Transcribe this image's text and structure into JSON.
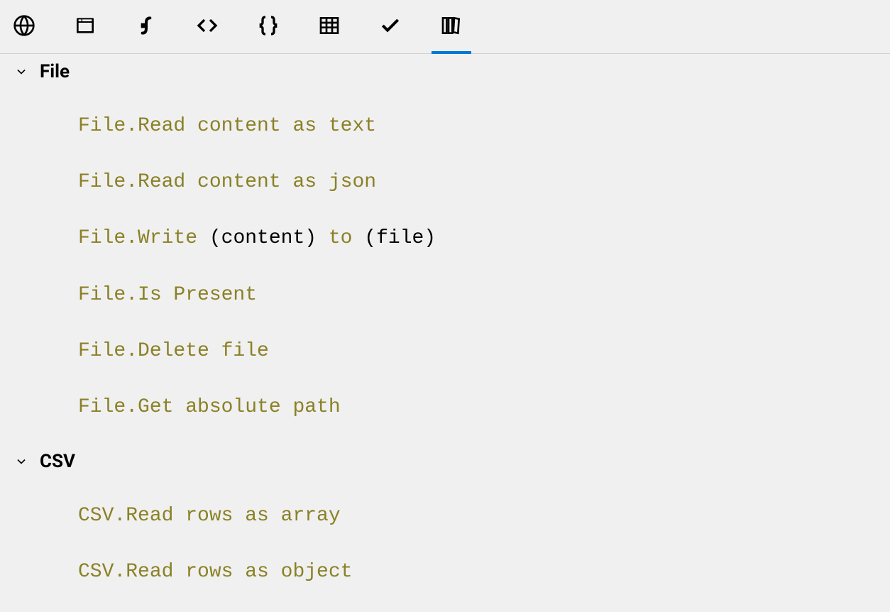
{
  "toolbar": {
    "tabs": [
      {
        "name": "globe-icon"
      },
      {
        "name": "browser-icon"
      },
      {
        "name": "function-icon"
      },
      {
        "name": "code-icon"
      },
      {
        "name": "braces-icon"
      },
      {
        "name": "table-icon"
      },
      {
        "name": "check-icon"
      },
      {
        "name": "library-icon"
      }
    ],
    "activeIndex": 7
  },
  "categories": [
    {
      "title": "File",
      "expanded": true,
      "items": [
        {
          "parts": [
            {
              "text": "File.Read content as text",
              "type": "kw"
            }
          ]
        },
        {
          "parts": [
            {
              "text": "File.Read content as json",
              "type": "kw"
            }
          ]
        },
        {
          "parts": [
            {
              "text": "File.Write",
              "type": "kw"
            },
            {
              "text": " (content) ",
              "type": "plain"
            },
            {
              "text": "to",
              "type": "kw"
            },
            {
              "text": " (file)",
              "type": "plain"
            }
          ]
        },
        {
          "parts": [
            {
              "text": "File.Is Present",
              "type": "kw"
            }
          ]
        },
        {
          "parts": [
            {
              "text": "File.Delete file",
              "type": "kw"
            }
          ]
        },
        {
          "parts": [
            {
              "text": "File.Get absolute path",
              "type": "kw"
            }
          ]
        }
      ]
    },
    {
      "title": "CSV",
      "expanded": true,
      "items": [
        {
          "parts": [
            {
              "text": "CSV.Read rows as array",
              "type": "kw"
            }
          ]
        },
        {
          "parts": [
            {
              "text": "CSV.Read rows as object",
              "type": "kw"
            }
          ]
        }
      ]
    }
  ]
}
